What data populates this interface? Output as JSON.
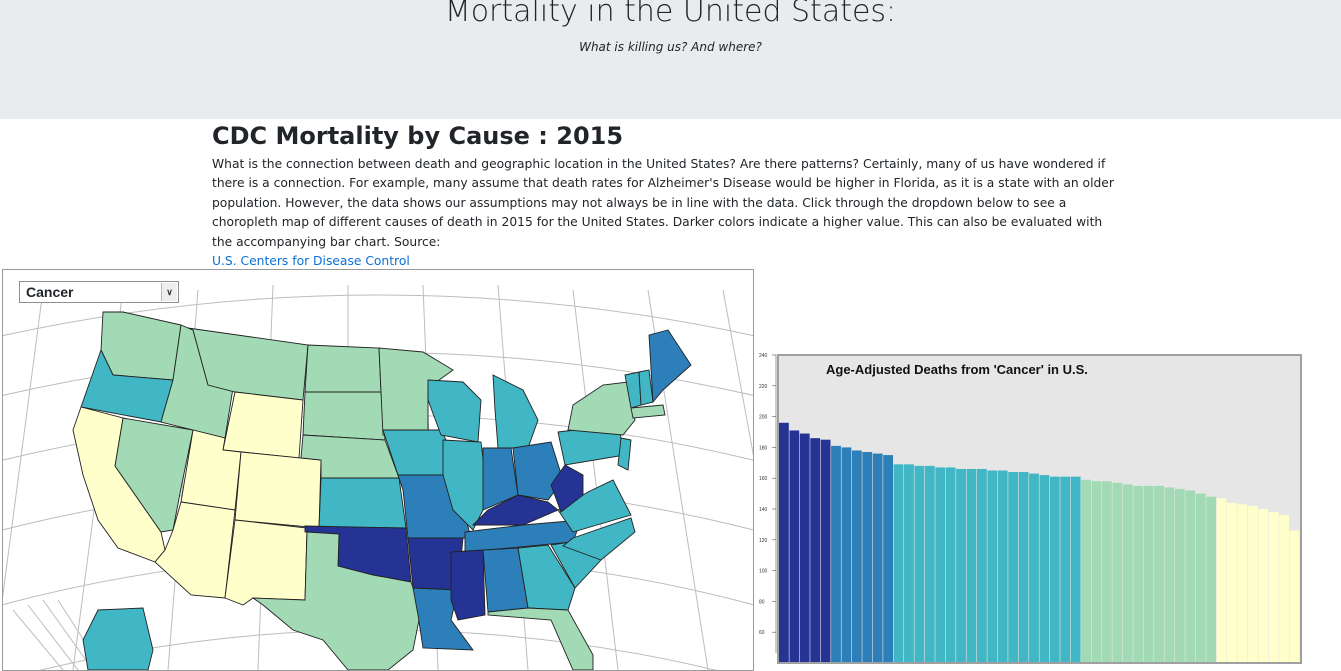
{
  "header": {
    "title": "Mortality in the United States:",
    "subtitle": "What is killing us? And where?"
  },
  "intro": {
    "heading": "CDC Mortality by Cause : 2015",
    "paragraph": "What is the connection between death and geographic location in the United States? Are there patterns? Certainly, many of us have wondered if there is a connection. For example, many assume that death rates for Alzheimer's Disease would be higher in Florida, as it is a state with an older population. However, the data shows our assumptions may not always be in line with the data. Click through the dropdown below to see a choropleth map of different causes of death in 2015 for the United States. Darker colors indicate a higher value. This can also be evaluated with the accompanying bar chart. Source:",
    "source_link": "U.S. Centers for Disease Control"
  },
  "map": {
    "selected_cause": "Cancer",
    "color_scale": [
      "#ffffcc",
      "#a1dab4",
      "#41b6c4",
      "#2c7fb8",
      "#253494"
    ]
  },
  "chart_data": {
    "type": "bar",
    "title": "Age-Adjusted Deaths from 'Cancer' in U.S.",
    "xlabel": "",
    "ylabel": "",
    "ylim": [
      60,
      240
    ],
    "yticks": [
      60,
      80,
      100,
      120,
      140,
      160,
      180,
      200,
      220,
      240
    ],
    "values": [
      196,
      191,
      189,
      186,
      185,
      181,
      180,
      178,
      177,
      176,
      175,
      169,
      169,
      168,
      168,
      167,
      167,
      166,
      166,
      166,
      165,
      165,
      164,
      164,
      163,
      162,
      161,
      161,
      161,
      159,
      158,
      158,
      157,
      156,
      155,
      155,
      155,
      154,
      153,
      152,
      150,
      148,
      147,
      144,
      143,
      142,
      140,
      138,
      136,
      126
    ],
    "bar_colors": [
      "#253494",
      "#253494",
      "#253494",
      "#253494",
      "#253494",
      "#2c7fb8",
      "#2c7fb8",
      "#2c7fb8",
      "#2c7fb8",
      "#2c7fb8",
      "#2c7fb8",
      "#41b6c4",
      "#41b6c4",
      "#41b6c4",
      "#41b6c4",
      "#41b6c4",
      "#41b6c4",
      "#41b6c4",
      "#41b6c4",
      "#41b6c4",
      "#41b6c4",
      "#41b6c4",
      "#41b6c4",
      "#41b6c4",
      "#41b6c4",
      "#41b6c4",
      "#41b6c4",
      "#41b6c4",
      "#41b6c4",
      "#a1dab4",
      "#a1dab4",
      "#a1dab4",
      "#a1dab4",
      "#a1dab4",
      "#a1dab4",
      "#a1dab4",
      "#a1dab4",
      "#a1dab4",
      "#a1dab4",
      "#a1dab4",
      "#a1dab4",
      "#a1dab4",
      "#ffffcc",
      "#ffffcc",
      "#ffffcc",
      "#ffffcc",
      "#ffffcc",
      "#ffffcc",
      "#ffffcc",
      "#ffffcc"
    ],
    "grid": false
  }
}
